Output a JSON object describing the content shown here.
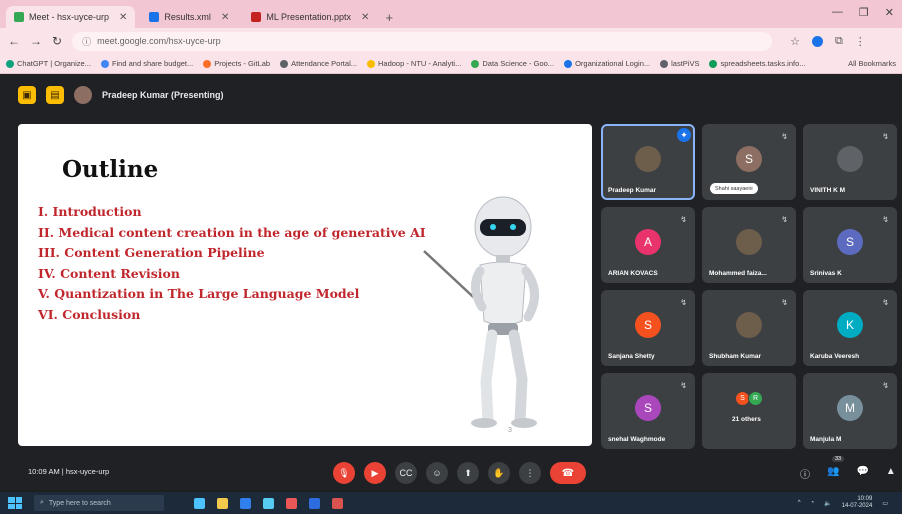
{
  "browser": {
    "tabs": [
      {
        "label": "Meet - hsx-uyce-urp",
        "active": true,
        "favicon_color": "#34a853"
      },
      {
        "label": "Results.xml",
        "active": false,
        "favicon_color": "#1a73e8"
      },
      {
        "label": "ML Presentation.pptx",
        "active": false,
        "favicon_color": "#c5221f"
      }
    ],
    "new_tab_label": "+",
    "address": "meet.google.com/hsx-uyce-urp",
    "bookmarks": [
      {
        "label": "ChatGPT | Organize...",
        "color": "#10a37f"
      },
      {
        "label": "Find and share budget...",
        "color": "#4285f4"
      },
      {
        "label": "Projects - GitLab",
        "color": "#fc6d26"
      },
      {
        "label": "Attendance Portal...",
        "color": "#5f6368"
      },
      {
        "label": "Hadoop - NTU - Analyti...",
        "color": "#fbbc04"
      },
      {
        "label": "Data Science - Goo...",
        "color": "#34a853"
      },
      {
        "label": "Organizational Login...",
        "color": "#1a73e8"
      },
      {
        "label": "lastPiVS",
        "color": "#5f6368"
      },
      {
        "label": "spreadsheets.tasks.info...",
        "color": "#0f9d58"
      }
    ],
    "bookmarks_right": "All Bookmarks"
  },
  "meet": {
    "presenter_label": "Pradeep Kumar (Presenting)",
    "slide": {
      "title": "Outline",
      "items": [
        "I. Introduction",
        "II. Medical content creation in the age of generative AI",
        "III. Content Generation Pipeline",
        "IV. Content Revision",
        "V. Quantization in The Large Language Model",
        "VI. Conclusion"
      ],
      "page_number": "3"
    },
    "participants": [
      {
        "name": "Pradeep Kumar",
        "initial": "",
        "color": "#6d5d4b",
        "photo": true,
        "active": true
      },
      {
        "name": "Shahi saayaeni",
        "initial": "S",
        "color": "#8d6e63",
        "photo": false,
        "tag": true
      },
      {
        "name": "VINITH K M",
        "initial": "",
        "color": "#5f6368",
        "photo": true
      },
      {
        "name": "ARIAN KOVACS",
        "initial": "A",
        "color": "#e8336d",
        "photo": false
      },
      {
        "name": "Mohammed faiza...",
        "initial": "",
        "color": "#6d5d4b",
        "photo": true
      },
      {
        "name": "Srinivas K",
        "initial": "S",
        "color": "#5c6bc0",
        "photo": false
      },
      {
        "name": "Sanjana Shetty",
        "initial": "S",
        "color": "#f4511e",
        "photo": false
      },
      {
        "name": "Shubham Kumar",
        "initial": "",
        "color": "#6d5d4b",
        "photo": true
      },
      {
        "name": "Karuba Veeresh",
        "initial": "K",
        "color": "#00acc1",
        "photo": false
      },
      {
        "name": "snehal Waghmode",
        "initial": "S",
        "color": "#ab47bc",
        "photo": false
      },
      {
        "name": "21 others",
        "initial": "",
        "color": "#3c4043",
        "photo": false,
        "group": true
      },
      {
        "name": "Manjula M",
        "initial": "M",
        "color": "#78909c",
        "photo": false
      }
    ],
    "others_avatars": [
      {
        "initial": "S",
        "color": "#f4511e"
      },
      {
        "initial": "R",
        "color": "#34a853"
      }
    ],
    "bottom": {
      "time": "10:09 AM",
      "meeting_code": "hsx-uyce-urp",
      "people_count": "33"
    }
  },
  "taskbar": {
    "search_placeholder": "Type here to search",
    "time": "10:09",
    "date": "14-07-2024"
  }
}
